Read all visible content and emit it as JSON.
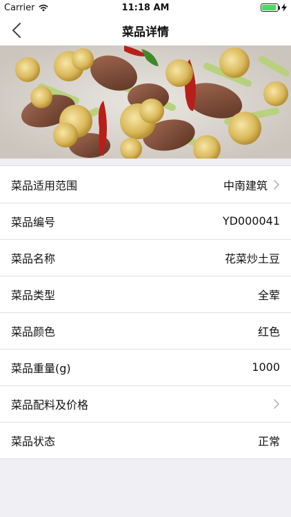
{
  "status_bar": {
    "carrier": "Carrier",
    "time": "11:18 AM",
    "battery_level": 0.92,
    "battery_color": "#4cd964"
  },
  "nav": {
    "title": "菜品详情",
    "back_icon": "chevron-left-icon"
  },
  "hero": {
    "image_subject": "stir-fried cauliflower with beef and red chili"
  },
  "details": [
    {
      "label": "菜品适用范围",
      "value": "中南建筑",
      "has_chevron": true
    },
    {
      "label": "菜品编号",
      "value": "YD000041",
      "has_chevron": false
    },
    {
      "label": "菜品名称",
      "value": "花菜炒土豆",
      "has_chevron": false
    },
    {
      "label": "菜品类型",
      "value": "全荤",
      "has_chevron": false
    },
    {
      "label": "菜品颜色",
      "value": "红色",
      "has_chevron": false
    },
    {
      "label": "菜品重量(g)",
      "value": "1000",
      "has_chevron": false
    },
    {
      "label": "菜品配料及价格",
      "value": "",
      "has_chevron": true
    },
    {
      "label": "菜品状态",
      "value": "正常",
      "has_chevron": false
    }
  ]
}
